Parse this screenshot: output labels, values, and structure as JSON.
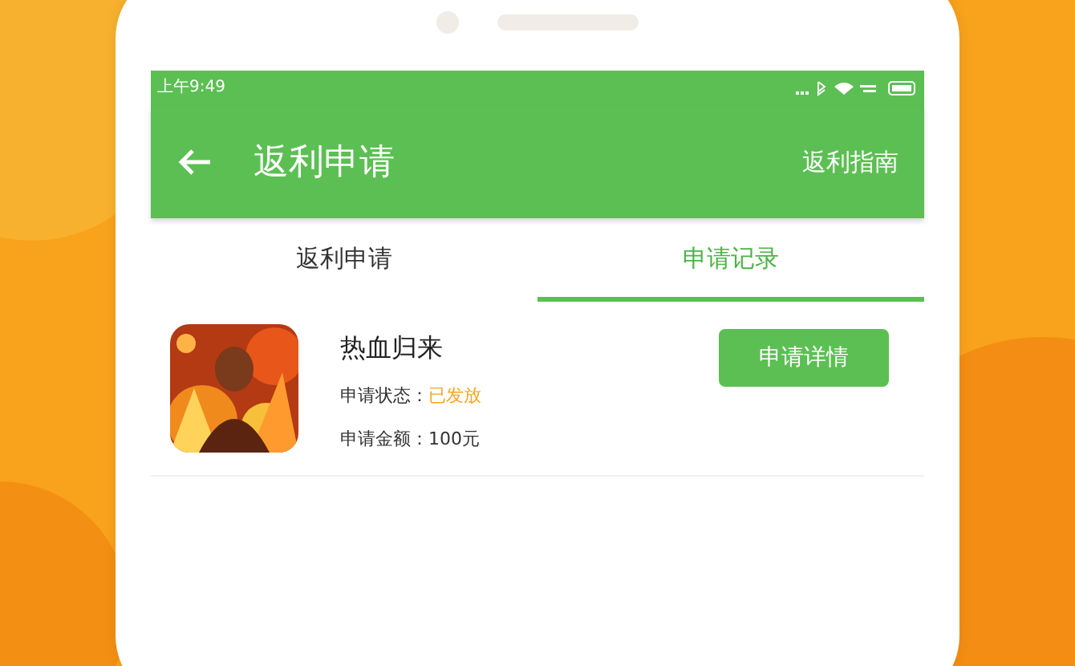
{
  "status_bar": {
    "time": "上午9:49"
  },
  "app_bar": {
    "title": "返利申请",
    "action": "返利指南"
  },
  "tabs": [
    {
      "label": "返利申请",
      "selected": false
    },
    {
      "label": "申请记录",
      "selected": true
    }
  ],
  "records": [
    {
      "game": "热血归来",
      "status_label": "申请状态：",
      "status": "已发放",
      "amount": "申请金额：100元",
      "button": "申请详情"
    }
  ]
}
